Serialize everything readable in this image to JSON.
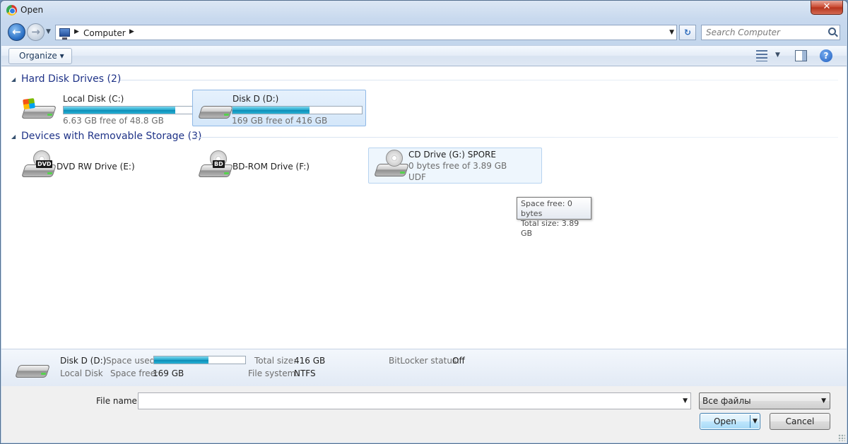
{
  "window": {
    "title": "Open",
    "close_label": "✕"
  },
  "nav": {
    "back_glyph": "←",
    "forward_glyph": "→",
    "breadcrumb": [
      "Computer"
    ],
    "search_placeholder": "Search Computer",
    "refresh_glyph": "↻"
  },
  "toolbar": {
    "organize_label": "Organize ▾",
    "help_label": "?"
  },
  "groups": [
    {
      "title": "Hard Disk Drives (2)",
      "items": [
        {
          "name": "Local Disk (C:)",
          "free_text": "6.63 GB free of 48.8 GB",
          "used_fraction": 0.864,
          "has_windows_logo": true,
          "selected": false
        },
        {
          "name": "Disk D (D:)",
          "free_text": "169 GB free of 416 GB",
          "used_fraction": 0.594,
          "has_windows_logo": false,
          "selected": true
        }
      ]
    },
    {
      "title": "Devices with Removable Storage (3)",
      "items": [
        {
          "name": "DVD RW Drive (E:)",
          "badge": "DVD"
        },
        {
          "name": "BD-ROM Drive (F:)",
          "badge": "BD"
        },
        {
          "name": "CD Drive (G:) SPORE",
          "free_text": "0 bytes free of 3.89 GB",
          "filesystem": "UDF",
          "hovered": true
        }
      ]
    }
  ],
  "tooltip": {
    "line1": "Space free: 0 bytes",
    "line2": "Total size: 3.89 GB"
  },
  "details": {
    "name": "Disk D (D:)",
    "type": "Local Disk",
    "space_used_label": "Space used:",
    "space_used_fraction": 0.594,
    "space_free_label": "Space free:",
    "space_free_value": "169 GB",
    "total_size_label": "Total size:",
    "total_size_value": "416 GB",
    "file_system_label": "File system:",
    "file_system_value": "NTFS",
    "bitlocker_label": "BitLocker status:",
    "bitlocker_value": "Off"
  },
  "bottom": {
    "file_name_label": "File name:",
    "file_name_value": "",
    "filter_value": "Все файлы",
    "open_label": "Open",
    "cancel_label": "Cancel"
  }
}
